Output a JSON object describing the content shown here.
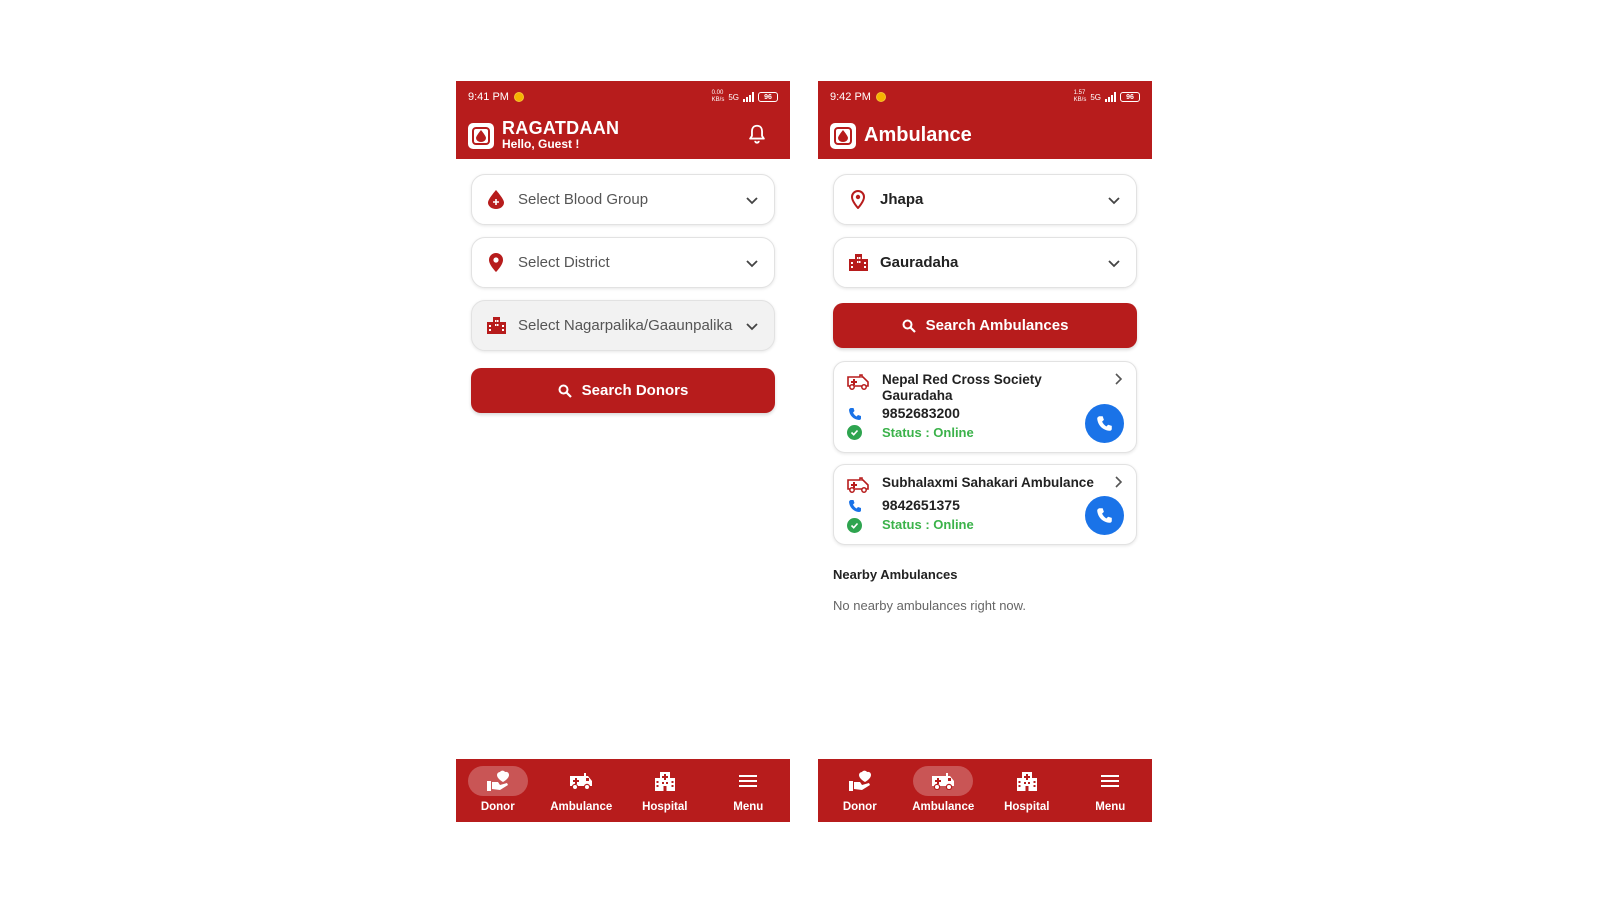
{
  "colors": {
    "primary": "#b71c1c",
    "call_button": "#1a73e8",
    "online": "#3bb24a"
  },
  "donor_screen": {
    "status_bar": {
      "time": "9:41 PM",
      "net_speed": "0.00\nKB/s",
      "network": "5G",
      "battery": "96"
    },
    "app_title": "RAGATDAAN",
    "greeting": "Hello, Guest !",
    "notification_icon": "bell-icon",
    "fields": [
      {
        "icon": "blood-drop-icon",
        "placeholder": "Select Blood Group"
      },
      {
        "icon": "location-pin-icon",
        "placeholder": "Select District"
      },
      {
        "icon": "building-icon",
        "placeholder": "Select Nagarpalika/Gaaunpalika"
      }
    ],
    "search_button": "Search Donors"
  },
  "ambulance_screen": {
    "status_bar": {
      "time": "9:42 PM",
      "net_speed": "1.57\nKB/s",
      "network": "5G",
      "battery": "96"
    },
    "title": "Ambulance",
    "district_value": "Jhapa",
    "municipality_value": "Gauradaha",
    "search_button": "Search Ambulances",
    "results": [
      {
        "name": "Nepal Red Cross Society Gauradaha",
        "phone": "9852683200",
        "status": "Status : Online"
      },
      {
        "name": "Subhalaxmi Sahakari Ambulance",
        "phone": "9842651375",
        "status": "Status : Online"
      }
    ],
    "nearby_title": "Nearby Ambulances",
    "nearby_empty": "No nearby ambulances right now."
  },
  "bottom_nav": {
    "items": [
      {
        "label": "Donor",
        "icon": "donor-heart-hand-icon"
      },
      {
        "label": "Ambulance",
        "icon": "ambulance-icon"
      },
      {
        "label": "Hospital",
        "icon": "hospital-icon"
      },
      {
        "label": "Menu",
        "icon": "menu-icon"
      }
    ]
  }
}
